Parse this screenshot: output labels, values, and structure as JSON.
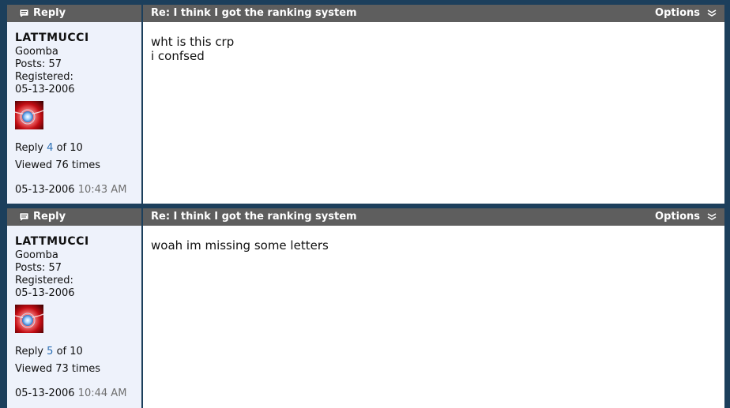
{
  "colors": {
    "header_bar": "#5e5e5e",
    "user_panel": "#eef2fb",
    "link": "#2b6fb5",
    "page_background": "#1c3f5c"
  },
  "icons": {
    "reply": "speech-bubble-icon",
    "options": "double-chevron-down-icon",
    "avatar": "red-glowing-orb-avatar"
  },
  "posts": [
    {
      "reply_label": "Reply",
      "title": "Re: I think I got the ranking system",
      "options_label": "Options",
      "author": {
        "username": "LATTMUCCI",
        "rank": "Goomba",
        "posts": "Posts: 57",
        "registered_label": "Registered:",
        "registered_date": "05-13-2006"
      },
      "reply_prefix": "Reply",
      "reply_number": "4",
      "reply_suffix": "of 10",
      "viewed": "Viewed 76 times",
      "date": "05-13-2006",
      "time": "10:43 AM",
      "body_lines": [
        "wht is this crp",
        "i confsed"
      ]
    },
    {
      "reply_label": "Reply",
      "title": "Re: I think I got the ranking system",
      "options_label": "Options",
      "author": {
        "username": "LATTMUCCI",
        "rank": "Goomba",
        "posts": "Posts: 57",
        "registered_label": "Registered:",
        "registered_date": "05-13-2006"
      },
      "reply_prefix": "Reply",
      "reply_number": "5",
      "reply_suffix": "of 10",
      "viewed": "Viewed 73 times",
      "date": "05-13-2006",
      "time": "10:44 AM",
      "body_lines": [
        "woah im missing some letters"
      ]
    }
  ]
}
